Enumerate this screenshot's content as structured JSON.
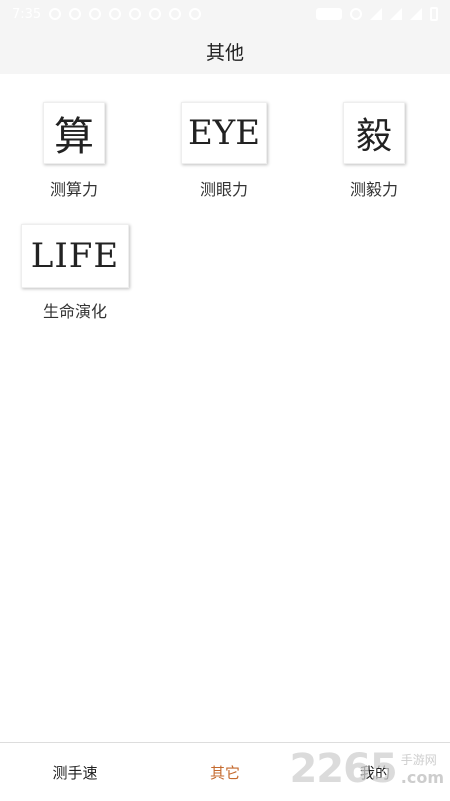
{
  "status_bar": {
    "time": "7:35"
  },
  "header": {
    "title": "其他"
  },
  "tiles": [
    {
      "glyph": "算",
      "label": "测算力"
    },
    {
      "glyph": "EYE",
      "label": "测眼力"
    },
    {
      "glyph": "毅",
      "label": "测毅力"
    },
    {
      "glyph": "LIFE",
      "label": "生命演化"
    }
  ],
  "tab_bar": {
    "tabs": [
      {
        "label": "测手速"
      },
      {
        "label": "其它"
      },
      {
        "label": "我的"
      }
    ],
    "active_color": "#c56a2e"
  },
  "watermark": {
    "number": "2265",
    "site_cn": "手游网",
    "site_en": ".com"
  }
}
